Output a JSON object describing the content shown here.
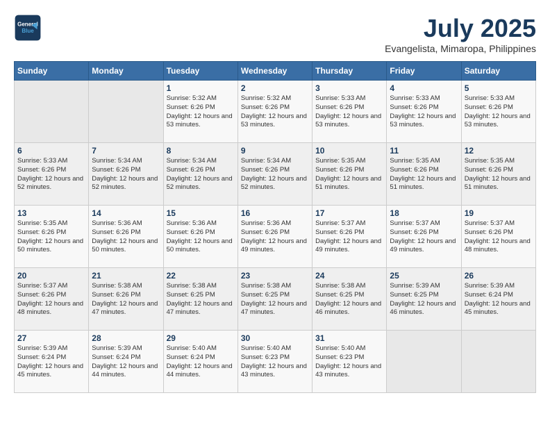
{
  "header": {
    "logo_line1": "General",
    "logo_line2": "Blue",
    "month_year": "July 2025",
    "location": "Evangelista, Mimaropa, Philippines"
  },
  "weekdays": [
    "Sunday",
    "Monday",
    "Tuesday",
    "Wednesday",
    "Thursday",
    "Friday",
    "Saturday"
  ],
  "weeks": [
    [
      {
        "day": "",
        "info": ""
      },
      {
        "day": "",
        "info": ""
      },
      {
        "day": "1",
        "info": "Sunrise: 5:32 AM\nSunset: 6:26 PM\nDaylight: 12 hours and 53 minutes."
      },
      {
        "day": "2",
        "info": "Sunrise: 5:32 AM\nSunset: 6:26 PM\nDaylight: 12 hours and 53 minutes."
      },
      {
        "day": "3",
        "info": "Sunrise: 5:33 AM\nSunset: 6:26 PM\nDaylight: 12 hours and 53 minutes."
      },
      {
        "day": "4",
        "info": "Sunrise: 5:33 AM\nSunset: 6:26 PM\nDaylight: 12 hours and 53 minutes."
      },
      {
        "day": "5",
        "info": "Sunrise: 5:33 AM\nSunset: 6:26 PM\nDaylight: 12 hours and 53 minutes."
      }
    ],
    [
      {
        "day": "6",
        "info": "Sunrise: 5:33 AM\nSunset: 6:26 PM\nDaylight: 12 hours and 52 minutes."
      },
      {
        "day": "7",
        "info": "Sunrise: 5:34 AM\nSunset: 6:26 PM\nDaylight: 12 hours and 52 minutes."
      },
      {
        "day": "8",
        "info": "Sunrise: 5:34 AM\nSunset: 6:26 PM\nDaylight: 12 hours and 52 minutes."
      },
      {
        "day": "9",
        "info": "Sunrise: 5:34 AM\nSunset: 6:26 PM\nDaylight: 12 hours and 52 minutes."
      },
      {
        "day": "10",
        "info": "Sunrise: 5:35 AM\nSunset: 6:26 PM\nDaylight: 12 hours and 51 minutes."
      },
      {
        "day": "11",
        "info": "Sunrise: 5:35 AM\nSunset: 6:26 PM\nDaylight: 12 hours and 51 minutes."
      },
      {
        "day": "12",
        "info": "Sunrise: 5:35 AM\nSunset: 6:26 PM\nDaylight: 12 hours and 51 minutes."
      }
    ],
    [
      {
        "day": "13",
        "info": "Sunrise: 5:35 AM\nSunset: 6:26 PM\nDaylight: 12 hours and 50 minutes."
      },
      {
        "day": "14",
        "info": "Sunrise: 5:36 AM\nSunset: 6:26 PM\nDaylight: 12 hours and 50 minutes."
      },
      {
        "day": "15",
        "info": "Sunrise: 5:36 AM\nSunset: 6:26 PM\nDaylight: 12 hours and 50 minutes."
      },
      {
        "day": "16",
        "info": "Sunrise: 5:36 AM\nSunset: 6:26 PM\nDaylight: 12 hours and 49 minutes."
      },
      {
        "day": "17",
        "info": "Sunrise: 5:37 AM\nSunset: 6:26 PM\nDaylight: 12 hours and 49 minutes."
      },
      {
        "day": "18",
        "info": "Sunrise: 5:37 AM\nSunset: 6:26 PM\nDaylight: 12 hours and 49 minutes."
      },
      {
        "day": "19",
        "info": "Sunrise: 5:37 AM\nSunset: 6:26 PM\nDaylight: 12 hours and 48 minutes."
      }
    ],
    [
      {
        "day": "20",
        "info": "Sunrise: 5:37 AM\nSunset: 6:26 PM\nDaylight: 12 hours and 48 minutes."
      },
      {
        "day": "21",
        "info": "Sunrise: 5:38 AM\nSunset: 6:26 PM\nDaylight: 12 hours and 47 minutes."
      },
      {
        "day": "22",
        "info": "Sunrise: 5:38 AM\nSunset: 6:25 PM\nDaylight: 12 hours and 47 minutes."
      },
      {
        "day": "23",
        "info": "Sunrise: 5:38 AM\nSunset: 6:25 PM\nDaylight: 12 hours and 47 minutes."
      },
      {
        "day": "24",
        "info": "Sunrise: 5:38 AM\nSunset: 6:25 PM\nDaylight: 12 hours and 46 minutes."
      },
      {
        "day": "25",
        "info": "Sunrise: 5:39 AM\nSunset: 6:25 PM\nDaylight: 12 hours and 46 minutes."
      },
      {
        "day": "26",
        "info": "Sunrise: 5:39 AM\nSunset: 6:24 PM\nDaylight: 12 hours and 45 minutes."
      }
    ],
    [
      {
        "day": "27",
        "info": "Sunrise: 5:39 AM\nSunset: 6:24 PM\nDaylight: 12 hours and 45 minutes."
      },
      {
        "day": "28",
        "info": "Sunrise: 5:39 AM\nSunset: 6:24 PM\nDaylight: 12 hours and 44 minutes."
      },
      {
        "day": "29",
        "info": "Sunrise: 5:40 AM\nSunset: 6:24 PM\nDaylight: 12 hours and 44 minutes."
      },
      {
        "day": "30",
        "info": "Sunrise: 5:40 AM\nSunset: 6:23 PM\nDaylight: 12 hours and 43 minutes."
      },
      {
        "day": "31",
        "info": "Sunrise: 5:40 AM\nSunset: 6:23 PM\nDaylight: 12 hours and 43 minutes."
      },
      {
        "day": "",
        "info": ""
      },
      {
        "day": "",
        "info": ""
      }
    ]
  ]
}
